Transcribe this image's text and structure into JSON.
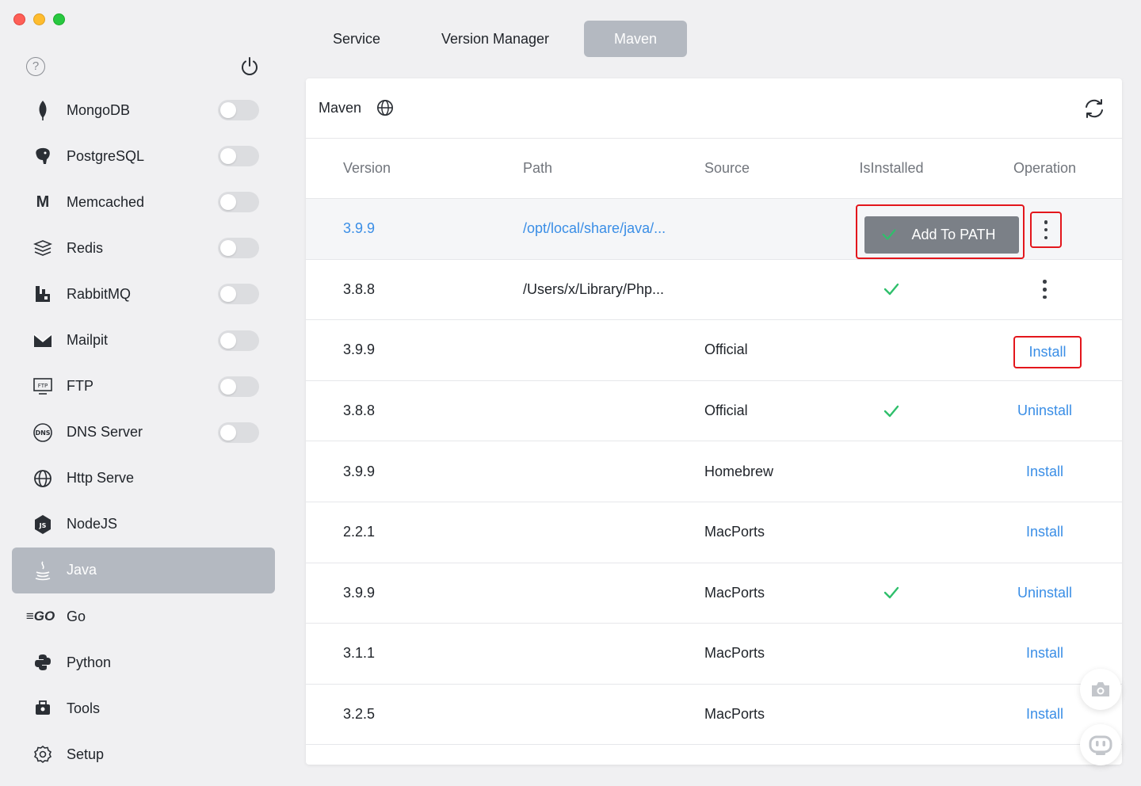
{
  "sidebar": {
    "items": [
      {
        "label": "MongoDB",
        "icon": "mongodb-icon",
        "toggle": false
      },
      {
        "label": "PostgreSQL",
        "icon": "postgresql-icon",
        "toggle": false
      },
      {
        "label": "Memcached",
        "icon": "memcached-icon",
        "toggle": false
      },
      {
        "label": "Redis",
        "icon": "redis-icon",
        "toggle": false
      },
      {
        "label": "RabbitMQ",
        "icon": "rabbitmq-icon",
        "toggle": false
      },
      {
        "label": "Mailpit",
        "icon": "mailpit-icon",
        "toggle": false
      },
      {
        "label": "FTP",
        "icon": "ftp-icon",
        "toggle": false
      },
      {
        "label": "DNS Server",
        "icon": "dns-icon",
        "toggle": false
      },
      {
        "label": "Http Serve",
        "icon": "globe-icon"
      },
      {
        "label": "NodeJS",
        "icon": "nodejs-icon"
      },
      {
        "label": "Java",
        "icon": "java-icon",
        "active": true
      },
      {
        "label": "Go",
        "icon": "go-icon"
      },
      {
        "label": "Python",
        "icon": "python-icon"
      },
      {
        "label": "Tools",
        "icon": "toolbox-icon"
      },
      {
        "label": "Setup",
        "icon": "gear-icon"
      }
    ]
  },
  "tabs": [
    {
      "label": "Service"
    },
    {
      "label": "Version Manager"
    },
    {
      "label": "Maven",
      "active": true
    }
  ],
  "panel": {
    "title": "Maven",
    "columns": [
      "Version",
      "Path",
      "Source",
      "IsInstalled",
      "Operation"
    ],
    "rows": [
      {
        "version": "3.9.9",
        "path": "/opt/local/share/java/...",
        "source": "",
        "installed": true,
        "operation": "Add To PATH"
      },
      {
        "version": "3.8.8",
        "path": "/Users/x/Library/Php...",
        "source": "",
        "installed": true,
        "operation": "more"
      },
      {
        "version": "3.9.9",
        "path": "",
        "source": "Official",
        "installed": false,
        "operation": "Install"
      },
      {
        "version": "3.8.8",
        "path": "",
        "source": "Official",
        "installed": true,
        "operation": "Uninstall"
      },
      {
        "version": "3.9.9",
        "path": "",
        "source": "Homebrew",
        "installed": false,
        "operation": "Install"
      },
      {
        "version": "2.2.1",
        "path": "",
        "source": "MacPorts",
        "installed": false,
        "operation": "Install"
      },
      {
        "version": "3.9.9",
        "path": "",
        "source": "MacPorts",
        "installed": true,
        "operation": "Uninstall"
      },
      {
        "version": "3.1.1",
        "path": "",
        "source": "MacPorts",
        "installed": false,
        "operation": "Install"
      },
      {
        "version": "3.2.5",
        "path": "",
        "source": "MacPorts",
        "installed": false,
        "operation": "Install"
      }
    ]
  },
  "colors": {
    "accent": "#3a8ee6",
    "check": "#2fbf6b",
    "highlight_box": "#e3161c",
    "active_bg": "#b4b9c1"
  }
}
